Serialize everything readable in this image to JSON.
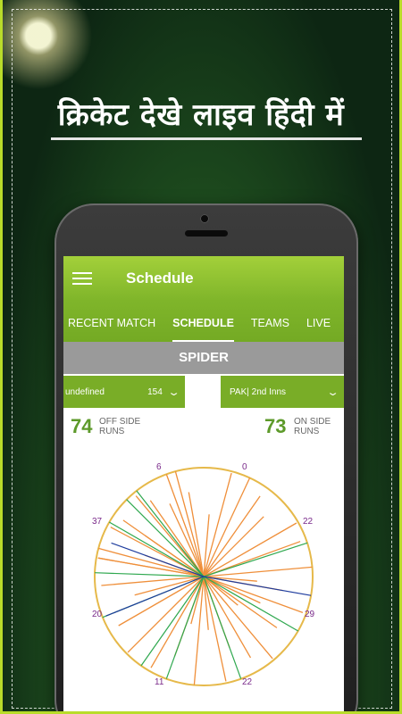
{
  "banner": {
    "title": "क्रिकेट देखे लाइव हिंदी में"
  },
  "appbar": {
    "title": "Schedule"
  },
  "tabs": [
    {
      "label": "RECENT MATCH",
      "active": false
    },
    {
      "label": "SCHEDULE",
      "active": true
    },
    {
      "label": "TEAMS",
      "active": false
    },
    {
      "label": "LIVE",
      "active": false
    }
  ],
  "section": {
    "title": "SPIDER"
  },
  "selectors": {
    "left": {
      "label": "undefined",
      "value": "154"
    },
    "right": {
      "label": "PAK| 2nd Inns"
    }
  },
  "stats": {
    "off": {
      "value": "74",
      "label_line1": "OFF SIDE",
      "label_line2": "RUNS"
    },
    "on": {
      "value": "73",
      "label_line1": "ON SIDE",
      "label_line2": "RUNS"
    }
  },
  "wagon_zones": [
    "6",
    "0",
    "22",
    "29",
    "22",
    "11",
    "20",
    "37"
  ],
  "colors": {
    "accent": "#7fb52a",
    "circle": "#e6b94a",
    "four": "#2fa84f",
    "six": "#1f3d9e",
    "run": "#ef8f3a"
  }
}
